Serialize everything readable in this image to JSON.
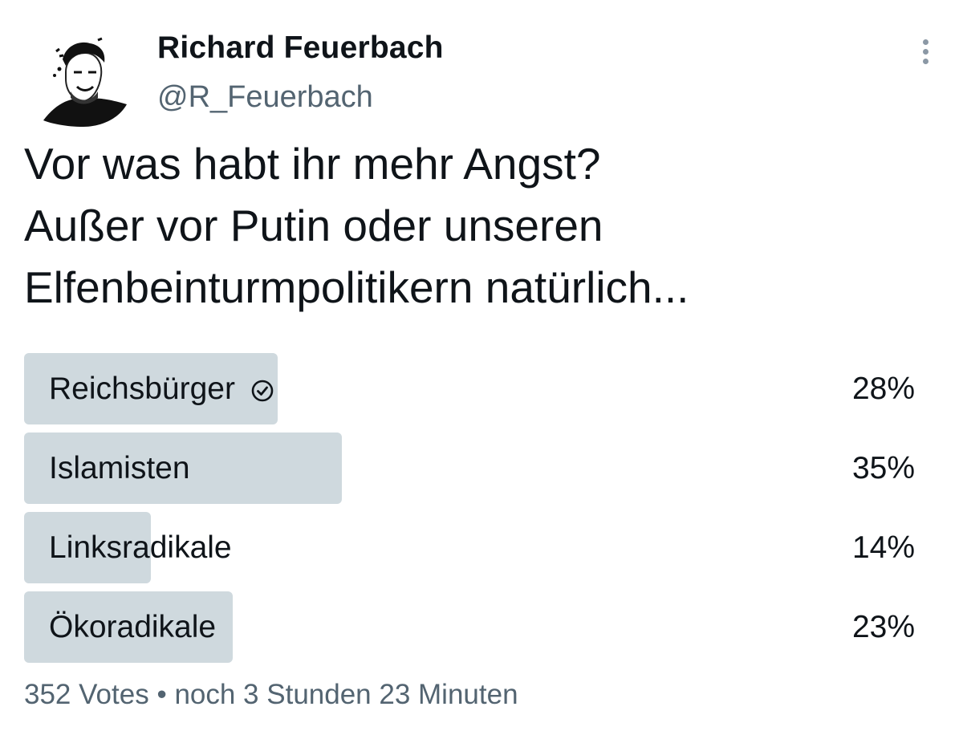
{
  "author": {
    "name": "Richard Feuerbach",
    "handle": "@R_Feuerbach",
    "avatar_icon": "profile-photo"
  },
  "menu_icon": "more-vertical-icon",
  "tweet": {
    "lines": [
      "Vor was habt ihr mehr Angst?",
      "Außer vor Putin oder unseren",
      "Elfenbeinturmpolitikern natürlich..."
    ]
  },
  "poll": {
    "options": [
      {
        "label": "Reichsbürger",
        "percent": "28%",
        "fraction": 0.28,
        "user_choice": true
      },
      {
        "label": "Islamisten",
        "percent": "35%",
        "fraction": 0.35,
        "user_choice": false
      },
      {
        "label": "Linksradikale",
        "percent": "14%",
        "fraction": 0.14,
        "user_choice": false
      },
      {
        "label": "Ökoradikale",
        "percent": "23%",
        "fraction": 0.23,
        "user_choice": false
      }
    ],
    "votes": "352 Votes",
    "separator": "•",
    "time_left": "noch 3 Stunden 23 Minuten"
  },
  "colors": {
    "bar": "#cfd9de",
    "text": "#0f1419",
    "secondary": "#536471"
  }
}
